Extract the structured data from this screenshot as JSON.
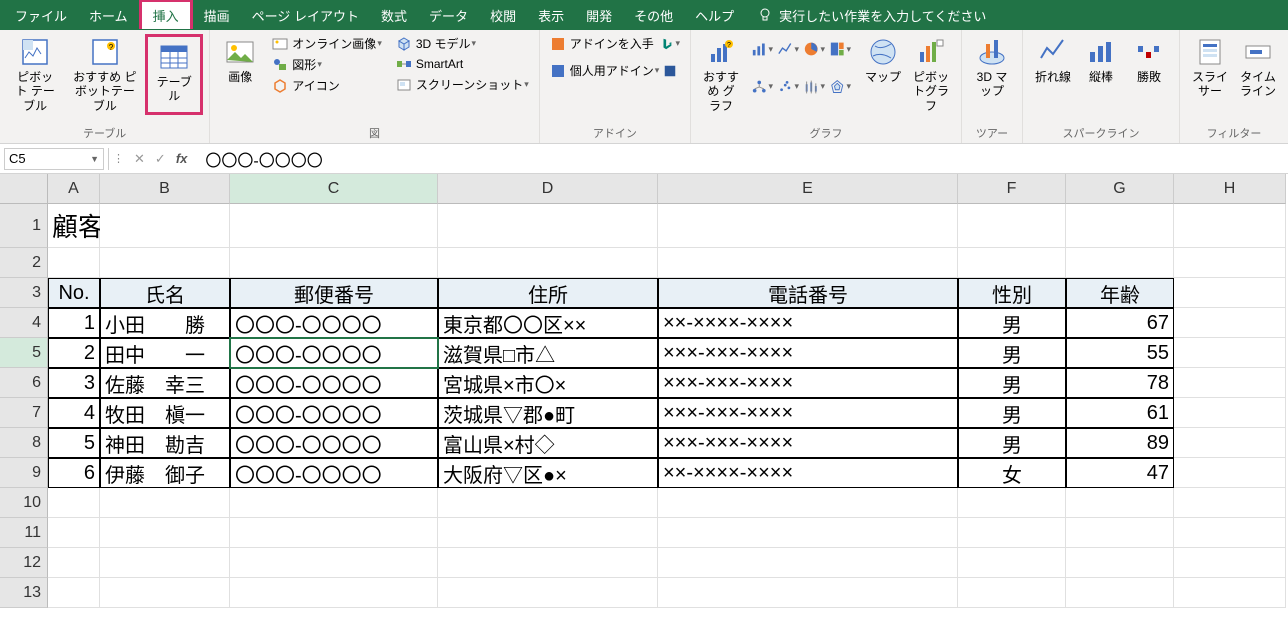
{
  "menu": [
    "ファイル",
    "ホーム",
    "挿入",
    "描画",
    "ページ レイアウト",
    "数式",
    "データ",
    "校閲",
    "表示",
    "開発",
    "その他",
    "ヘルプ"
  ],
  "menu_selected": 2,
  "tell_me": "実行したい作業を入力してください",
  "ribbon": {
    "tables": {
      "pivot": "ピボット\nテーブル",
      "recommend": "おすすめ\nピボットテーブル",
      "table": "テーブル",
      "label": "テーブル"
    },
    "illust": {
      "image": "画像",
      "online_img": "オンライン画像",
      "shapes": "図形",
      "icons": "アイコン",
      "model3d": "3D モデル",
      "smartart": "SmartArt",
      "screenshot": "スクリーンショット",
      "label": "図"
    },
    "addins": {
      "get": "アドインを入手",
      "my": "個人用アドイン",
      "label": "アドイン"
    },
    "charts": {
      "recommend": "おすすめ\nグラフ",
      "map": "マップ",
      "pivotchart": "ピボットグラフ",
      "label": "グラフ"
    },
    "tours": {
      "map3d": "3D\nマップ",
      "label": "ツアー"
    },
    "spark": {
      "line": "折れ線",
      "column": "縦棒",
      "winloss": "勝敗",
      "label": "スパークライン"
    },
    "filter": {
      "slicer": "スライサー",
      "timeline": "タイム\nライン",
      "label": "フィルター"
    }
  },
  "nameBox": "C5",
  "formula": "〇〇〇-〇〇〇〇",
  "columns": [
    "A",
    "B",
    "C",
    "D",
    "E",
    "F",
    "G",
    "H"
  ],
  "rows": [
    "1",
    "2",
    "3",
    "4",
    "5",
    "6",
    "7",
    "8",
    "9",
    "10",
    "11",
    "12",
    "13"
  ],
  "activeCol": "C",
  "activeRow": "5",
  "sheetTitle": "顧客管理リスト",
  "headers": [
    "No.",
    "氏名",
    "郵便番号",
    "住所",
    "電話番号",
    "性別",
    "年齢"
  ],
  "data": [
    {
      "no": "1",
      "name": "小田　　勝",
      "zip": "〇〇〇-〇〇〇〇",
      "addr": "東京都〇〇区××",
      "tel": "××-××××-××××",
      "sex": "男",
      "age": "67"
    },
    {
      "no": "2",
      "name": "田中　　一",
      "zip": "〇〇〇-〇〇〇〇",
      "addr": "滋賀県□市△",
      "tel": "×××-×××-××××",
      "sex": "男",
      "age": "55"
    },
    {
      "no": "3",
      "name": "佐藤　幸三",
      "zip": "〇〇〇-〇〇〇〇",
      "addr": "宮城県×市〇×",
      "tel": "×××-×××-××××",
      "sex": "男",
      "age": "78"
    },
    {
      "no": "4",
      "name": "牧田　槇一",
      "zip": "〇〇〇-〇〇〇〇",
      "addr": "茨城県▽郡●町",
      "tel": "×××-×××-××××",
      "sex": "男",
      "age": "61"
    },
    {
      "no": "5",
      "name": "神田　勘吉",
      "zip": "〇〇〇-〇〇〇〇",
      "addr": "富山県×村◇",
      "tel": "×××-×××-××××",
      "sex": "男",
      "age": "89"
    },
    {
      "no": "6",
      "name": "伊藤　御子",
      "zip": "〇〇〇-〇〇〇〇",
      "addr": "大阪府▽区●×",
      "tel": "××-××××-××××",
      "sex": "女",
      "age": "47"
    }
  ]
}
